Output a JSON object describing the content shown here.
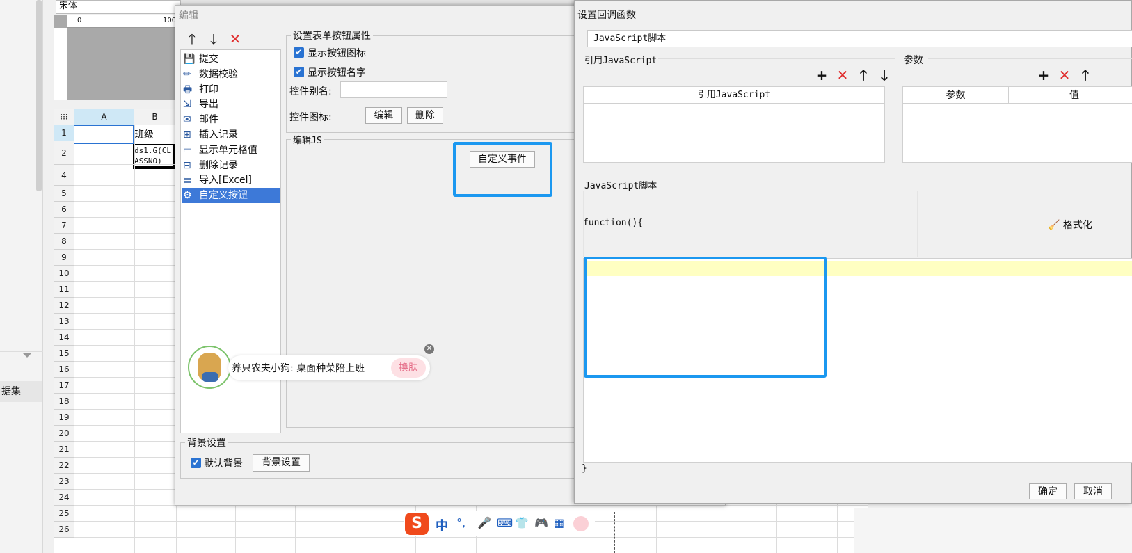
{
  "background_app": {
    "font_select": "宋体",
    "ruler_label_0": "0",
    "ruler_label_100": "100",
    "side_label": "据集",
    "columns": [
      "A",
      "B"
    ],
    "rows": [
      "1",
      "2",
      "4",
      "5",
      "6",
      "7",
      "8",
      "9",
      "10",
      "11",
      "12",
      "13",
      "14",
      "15",
      "16",
      "17",
      "18",
      "19",
      "20",
      "21",
      "22",
      "23",
      "24",
      "25",
      "26"
    ],
    "cell_b1": "班级",
    "cell_b2": "ds1.G(CLASSNO)"
  },
  "edit_dialog": {
    "title": "编辑",
    "toolbar": {
      "up_icon": "arrow-up-icon",
      "down_icon": "arrow-down-icon",
      "delete_icon": "delete-icon"
    },
    "tree_items": [
      {
        "label": "提交",
        "icon": "save-icon"
      },
      {
        "label": "数据校验",
        "icon": "pencil-icon"
      },
      {
        "label": "打印",
        "icon": "printer-icon"
      },
      {
        "label": "导出",
        "icon": "export-icon"
      },
      {
        "label": "邮件",
        "icon": "mail-icon"
      },
      {
        "label": "插入记录",
        "icon": "insert-row-icon"
      },
      {
        "label": "显示单元格值",
        "icon": "cell-icon"
      },
      {
        "label": "删除记录",
        "icon": "delete-row-icon"
      },
      {
        "label": "导入[Excel]",
        "icon": "excel-icon"
      },
      {
        "label": "自定义按钮",
        "icon": "gear-icon",
        "selected": true
      }
    ],
    "props_legend": "设置表单按钮属性",
    "show_icon_label": "显示按钮图标",
    "show_name_label": "显示按钮名字",
    "alias_label": "控件别名:",
    "alias_value": "",
    "icon_label": "控件图标:",
    "edit_btn": "编辑",
    "delete_btn": "删除",
    "js_legend": "编辑JS",
    "custom_event_btn": "自定义事件",
    "bg_legend": "背景设置",
    "default_bg_label": "默认背景",
    "bg_settings_btn": "背景设置"
  },
  "callback_dialog": {
    "title": "设置回调函数",
    "type_select": "JavaScript脚本",
    "ref_js_legend": "引用JavaScript",
    "ref_js_header": "引用JavaScript",
    "params_legend": "参数",
    "param_header": "参数",
    "value_header": "值",
    "script_legend": "JavaScript脚本",
    "function_open": "function(){",
    "function_close": "}",
    "format_btn": "格式化",
    "ok_btn": "确定",
    "cancel_btn": "取消"
  },
  "ad_popup": {
    "text": "养只农夫小狗: 桌面种菜陪上班",
    "button": "换肤"
  },
  "ime_bar": {
    "lang": "中",
    "punct": "°,"
  },
  "colors": {
    "highlight": "#1b98f0",
    "selection": "#3d79d8",
    "editor_line": "#ffffc2",
    "delete_red": "#e03030"
  }
}
